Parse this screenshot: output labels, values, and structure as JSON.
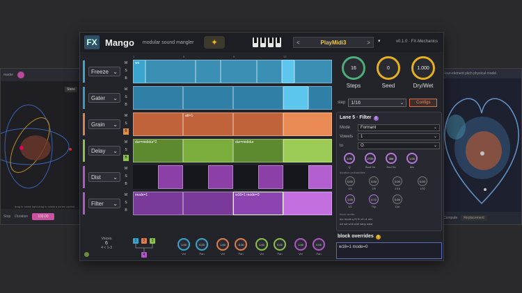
{
  "left_panel": {
    "header_text": "mader",
    "button_label": "Stere",
    "footer_stop": "Stop",
    "footer_duration_label": "Duration",
    "footer_duration_value": "100.00",
    "hint_text": "drag to rotate     right-drag to rotate a series     control-..."
  },
  "right_panel": {
    "header_text": "Four-element pitch physical model",
    "footer_label": "Compute",
    "footer_value": "Replacement"
  },
  "header": {
    "logo": "FX",
    "title": "Mango",
    "subtitle": "modular sound mangler",
    "preset_name": "PlayMidi3",
    "prev": "<",
    "next": ">",
    "menu": "▾",
    "version": "v0.1.0 · FX-Mechanics"
  },
  "ruler": [
    "1",
    "5",
    "9",
    "13"
  ],
  "lanes": [
    {
      "name": "Freeze",
      "color": "#3aa6cf",
      "ms": [
        "M",
        "S",
        "B"
      ],
      "blocks": [
        {
          "label": "ws"
        },
        {
          "label": ""
        },
        {
          "label": ""
        },
        {
          "label": ""
        },
        {
          "label": ""
        },
        {
          "label": ""
        },
        {
          "label": ""
        }
      ]
    },
    {
      "name": "Gater",
      "color": "#3a98c4",
      "ms": [
        "M",
        "S",
        "B"
      ],
      "blocks": [
        {
          "label": ""
        },
        {
          "label": ""
        },
        {
          "label": ""
        },
        {
          "label": ""
        }
      ]
    },
    {
      "name": "Grain",
      "color": "#e27d4d",
      "ms": [
        "M",
        "S",
        "B"
      ],
      "blocks": [
        {
          "label": ""
        },
        {
          "label": "att=1"
        },
        {
          "label": ""
        },
        {
          "label": ""
        }
      ]
    },
    {
      "name": "Delay",
      "color": "#8bc34a",
      "ms": [
        "M",
        "S",
        "B"
      ],
      "blocks": [
        {
          "label": "dur=mididur*2"
        },
        {
          "label": ""
        },
        {
          "label": "dur=mididur"
        },
        {
          "label": ""
        }
      ]
    },
    {
      "name": "Dist",
      "color": "#b058c7",
      "ms": [
        "M",
        "S",
        "B"
      ],
      "blocks": [
        {
          "label": ""
        },
        {
          "label": ""
        },
        {
          "label": ""
        },
        {
          "label": ""
        }
      ]
    },
    {
      "name": "Filter",
      "color": "#b058c7",
      "ms": [
        "M",
        "S",
        "B"
      ],
      "blocks": [
        {
          "label": "mode=1"
        },
        {
          "label": ""
        },
        {
          "label": "w16=1 mode=0"
        },
        {
          "label": ""
        }
      ]
    }
  ],
  "mixer": {
    "voices_label": "Voices",
    "voices_value": "6",
    "range": "4 < 1-3",
    "tree_nodes": [
      "1",
      "2",
      "3",
      "4"
    ],
    "knobs": [
      {
        "label": "Vol",
        "value": "1.00"
      },
      {
        "label": "Pan",
        "value": "0.23"
      },
      {
        "label": "Vol",
        "value": "1.00"
      },
      {
        "label": "Pan",
        "value": "-0.30"
      },
      {
        "label": "Vol",
        "value": "1.00"
      },
      {
        "label": "Pan",
        "value": "0.00"
      },
      {
        "label": "Vol",
        "value": "1.00"
      },
      {
        "label": "Pan",
        "value": "0.00"
      }
    ]
  },
  "right": {
    "big_knobs": [
      {
        "label": "Steps",
        "value": "16",
        "color": "#4caf7a"
      },
      {
        "label": "Seed",
        "value": "0",
        "color": "#e6b020"
      },
      {
        "label": "Dry/Wet",
        "value": "1.000",
        "color": "#e6b020"
      }
    ],
    "step_label": "step",
    "step_value": "1/16",
    "configs_label": "Configs",
    "lane_title": "Lane 5 · Filter",
    "fields": [
      {
        "label": "Mode",
        "value": "Formant"
      },
      {
        "label": "Vowels",
        "value": "1"
      },
      {
        "label": "to",
        "value": "O"
      }
    ],
    "purple_knobs": [
      {
        "label": "Q",
        "value": "1.00"
      },
      {
        "label": "Start Hz",
        "value": "2725"
      },
      {
        "label": "End Hz",
        "value": "368"
      },
      {
        "label": "Mix",
        "value": "1.00"
      }
    ],
    "prob_title": "duration probabilities",
    "prob_knobs": [
      {
        "tag": "1/4",
        "value": "0.00"
      },
      {
        "tag": "1/8",
        "value": "0.00"
      },
      {
        "tag": "1/16",
        "value": "0.00"
      },
      {
        "tag": "1/32",
        "value": "0.00"
      },
      {
        "tag": "1/2",
        "value": "1.00"
      },
      {
        "tag": "Trip",
        "value": "0.72"
      },
      {
        "tag": "Dot",
        "value": "0.00"
      }
    ],
    "note_line1": "block words:",
    "note_line2": "dur mode q f0 f1 v0 v1 mix",
    "note_line3": "w4 w8 w16 w32 wtrip wdot",
    "overrides_title": "block overrides",
    "overrides_text": "w16=1 mode=0"
  }
}
